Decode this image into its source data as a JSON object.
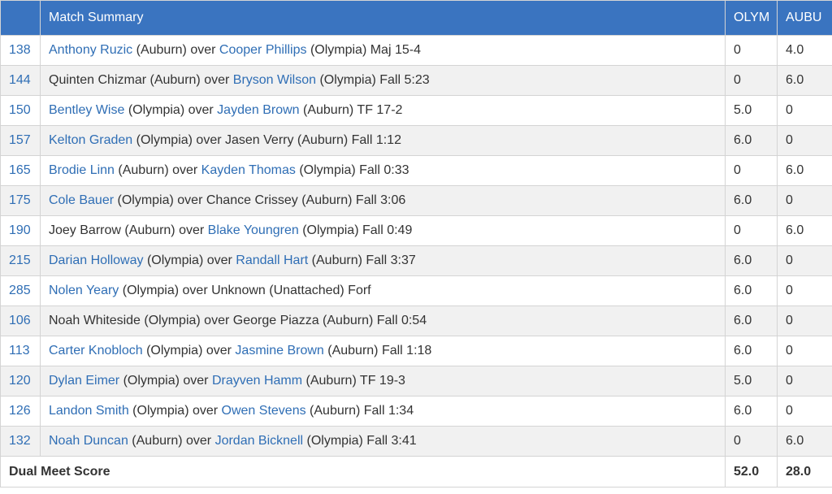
{
  "header": {
    "weight": "",
    "summary": "Match Summary",
    "team1": "OLYM",
    "team2": "AUBU"
  },
  "colors": {
    "header_bg": "#3a74c0",
    "link": "#2f6eb5",
    "stripe": "#f1f1f1",
    "border": "#d4d4d4"
  },
  "rows": [
    {
      "weight": "138",
      "p1": "Anthony Ruzic",
      "p1_link": true,
      "t1": " (Auburn) over ",
      "p2": "Cooper Phillips",
      "p2_link": true,
      "t2": " (Olympia) Maj 15-4",
      "s1": "0",
      "s2": "4.0"
    },
    {
      "weight": "144",
      "p1": "Quinten Chizmar",
      "p1_link": false,
      "t1": " (Auburn) over ",
      "p2": "Bryson Wilson",
      "p2_link": true,
      "t2": " (Olympia) Fall 5:23",
      "s1": "0",
      "s2": "6.0"
    },
    {
      "weight": "150",
      "p1": "Bentley Wise",
      "p1_link": true,
      "t1": " (Olympia) over ",
      "p2": "Jayden Brown",
      "p2_link": true,
      "t2": " (Auburn) TF 17-2",
      "s1": "5.0",
      "s2": "0"
    },
    {
      "weight": "157",
      "p1": "Kelton Graden",
      "p1_link": true,
      "t1": " (Olympia) over ",
      "p2": "Jasen Verry",
      "p2_link": false,
      "t2": " (Auburn) Fall 1:12",
      "s1": "6.0",
      "s2": "0"
    },
    {
      "weight": "165",
      "p1": "Brodie Linn",
      "p1_link": true,
      "t1": " (Auburn) over ",
      "p2": "Kayden Thomas",
      "p2_link": true,
      "t2": " (Olympia) Fall 0:33",
      "s1": "0",
      "s2": "6.0"
    },
    {
      "weight": "175",
      "p1": "Cole Bauer",
      "p1_link": true,
      "t1": " (Olympia) over ",
      "p2": "Chance Crissey",
      "p2_link": false,
      "t2": " (Auburn) Fall 3:06",
      "s1": "6.0",
      "s2": "0"
    },
    {
      "weight": "190",
      "p1": "Joey Barrow",
      "p1_link": false,
      "t1": " (Auburn) over ",
      "p2": "Blake Youngren",
      "p2_link": true,
      "t2": " (Olympia) Fall 0:49",
      "s1": "0",
      "s2": "6.0"
    },
    {
      "weight": "215",
      "p1": "Darian Holloway",
      "p1_link": true,
      "t1": " (Olympia) over ",
      "p2": "Randall Hart",
      "p2_link": true,
      "t2": " (Auburn) Fall 3:37",
      "s1": "6.0",
      "s2": "0"
    },
    {
      "weight": "285",
      "p1": "Nolen Yeary",
      "p1_link": true,
      "t1": " (Olympia) over ",
      "p2": "Unknown",
      "p2_link": false,
      "t2": " (Unattached) Forf",
      "s1": "6.0",
      "s2": "0"
    },
    {
      "weight": "106",
      "p1": "Noah Whiteside",
      "p1_link": false,
      "t1": " (Olympia) over ",
      "p2": "George Piazza",
      "p2_link": false,
      "t2": " (Auburn) Fall 0:54",
      "s1": "6.0",
      "s2": "0"
    },
    {
      "weight": "113",
      "p1": "Carter Knobloch",
      "p1_link": true,
      "t1": " (Olympia) over ",
      "p2": "Jasmine Brown",
      "p2_link": true,
      "t2": " (Auburn) Fall 1:18",
      "s1": "6.0",
      "s2": "0"
    },
    {
      "weight": "120",
      "p1": "Dylan Eimer",
      "p1_link": true,
      "t1": " (Olympia) over ",
      "p2": "Drayven Hamm",
      "p2_link": true,
      "t2": " (Auburn) TF 19-3",
      "s1": "5.0",
      "s2": "0"
    },
    {
      "weight": "126",
      "p1": "Landon Smith",
      "p1_link": true,
      "t1": " (Olympia) over ",
      "p2": "Owen Stevens",
      "p2_link": true,
      "t2": " (Auburn) Fall 1:34",
      "s1": "6.0",
      "s2": "0"
    },
    {
      "weight": "132",
      "p1": "Noah Duncan",
      "p1_link": true,
      "t1": " (Auburn) over ",
      "p2": "Jordan Bicknell",
      "p2_link": true,
      "t2": " (Olympia) Fall 3:41",
      "s1": "0",
      "s2": "6.0"
    }
  ],
  "footer": {
    "label": "Dual Meet Score",
    "team1_score": "52.0",
    "team2_score": "28.0"
  }
}
